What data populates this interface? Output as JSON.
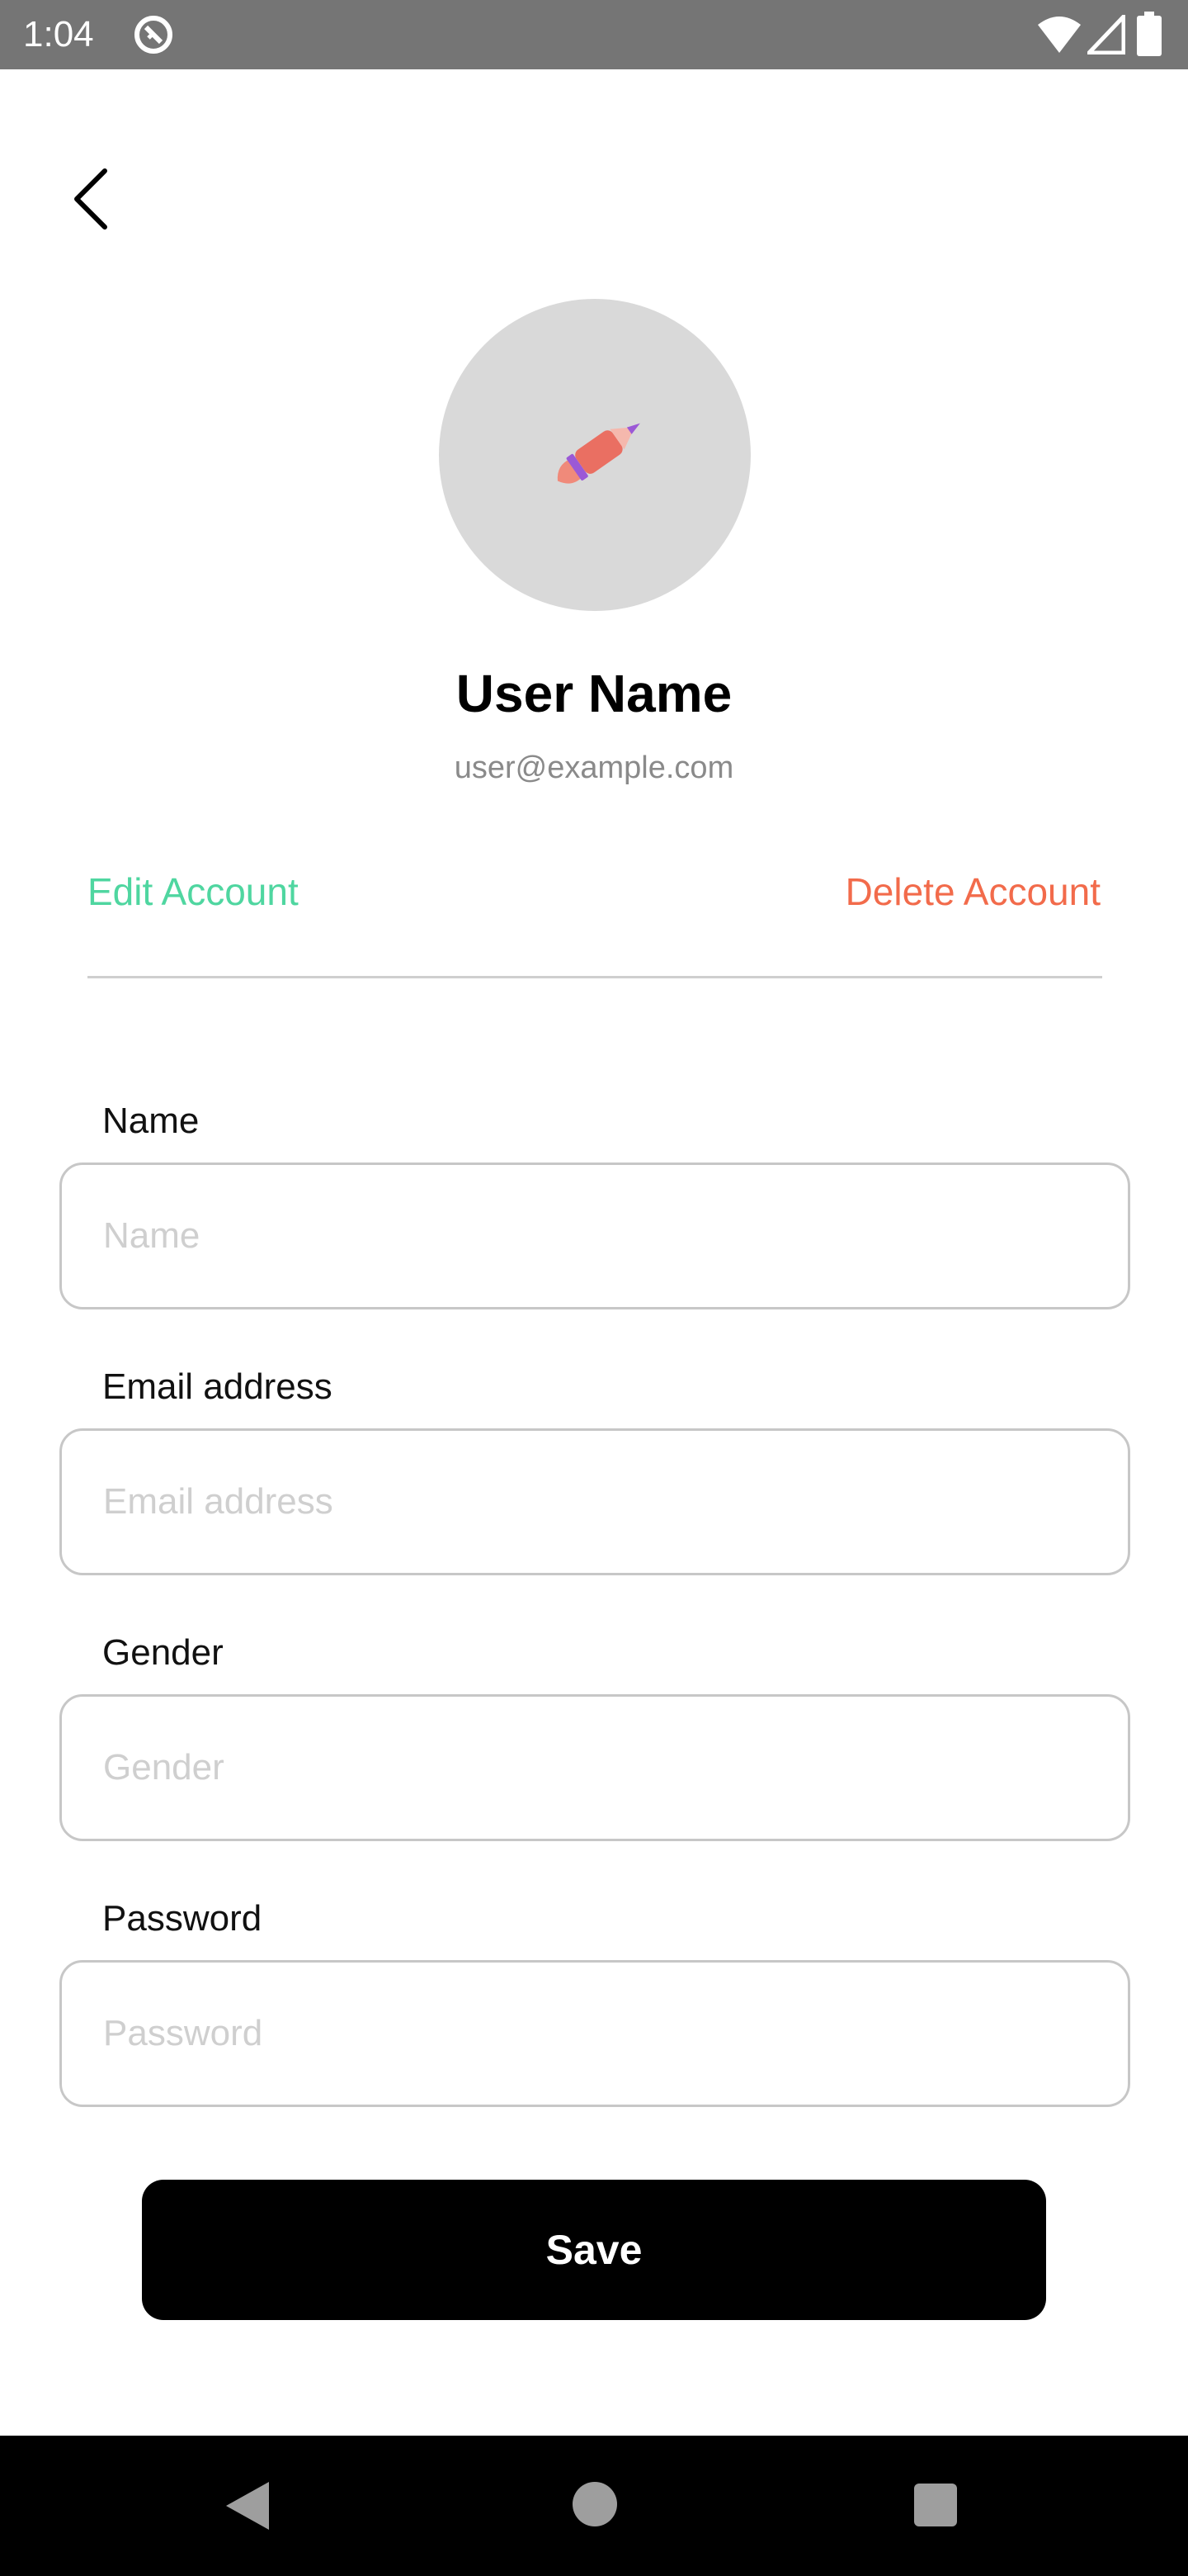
{
  "status_bar": {
    "time": "1:04",
    "icons": [
      "app-notification-icon",
      "wifi-icon",
      "signal-icon",
      "battery-icon"
    ]
  },
  "header": {
    "back_icon": "chevron-left-icon"
  },
  "profile": {
    "avatar_icon": "rocket-icon",
    "name": "User Name",
    "email": "user@example.com"
  },
  "actions": {
    "edit_label": "Edit Account",
    "delete_label": "Delete Account"
  },
  "form": {
    "fields": [
      {
        "label": "Name",
        "placeholder": "Name",
        "value": ""
      },
      {
        "label": "Email address",
        "placeholder": "Email address",
        "value": ""
      },
      {
        "label": "Gender",
        "placeholder": "Gender",
        "value": ""
      },
      {
        "label": "Password",
        "placeholder": "Password",
        "value": ""
      }
    ],
    "save_label": "Save"
  },
  "nav_bar": {
    "icons": [
      "nav-back-icon",
      "nav-home-icon",
      "nav-recents-icon"
    ]
  },
  "colors": {
    "status_bar": "#757575",
    "edit_accent": "#4fd6a0",
    "delete_accent": "#f26b4b",
    "avatar_bg": "#d9d9d9",
    "save_bg": "#000000"
  }
}
